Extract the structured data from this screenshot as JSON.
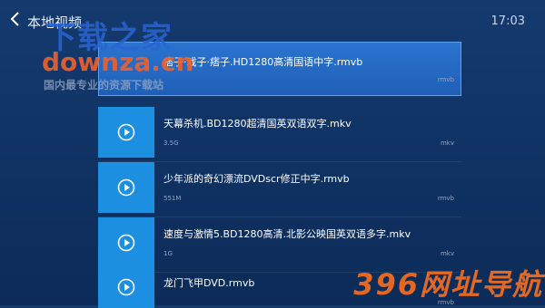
{
  "header": {
    "title": "本地视频",
    "time": "17:03"
  },
  "watermarks": {
    "cn": "下载之家",
    "en": "downza.cn",
    "sub": "国内最专业的资源下载站",
    "corner": "396网址导航"
  },
  "videos": [
    {
      "name": "痞子·戏子·痞子.HD1280高清国语中字.rmvb",
      "size": "",
      "ext": "rmvb",
      "selected": true
    },
    {
      "name": "天幕杀机.BD1280超清国英双语双字.mkv",
      "size": "3.5G",
      "ext": "mkv"
    },
    {
      "name": "少年派的奇幻漂流DVDscr修正中字.rmvb",
      "size": "551M",
      "ext": "rmvb"
    },
    {
      "name": "速度与激情5.BD1280高清.北影公映国英双语多字.mkv",
      "size": "1G",
      "ext": "mkv"
    },
    {
      "name": "龙门飞甲DVD.rmvb",
      "size": "",
      "ext": "rmvb"
    }
  ]
}
